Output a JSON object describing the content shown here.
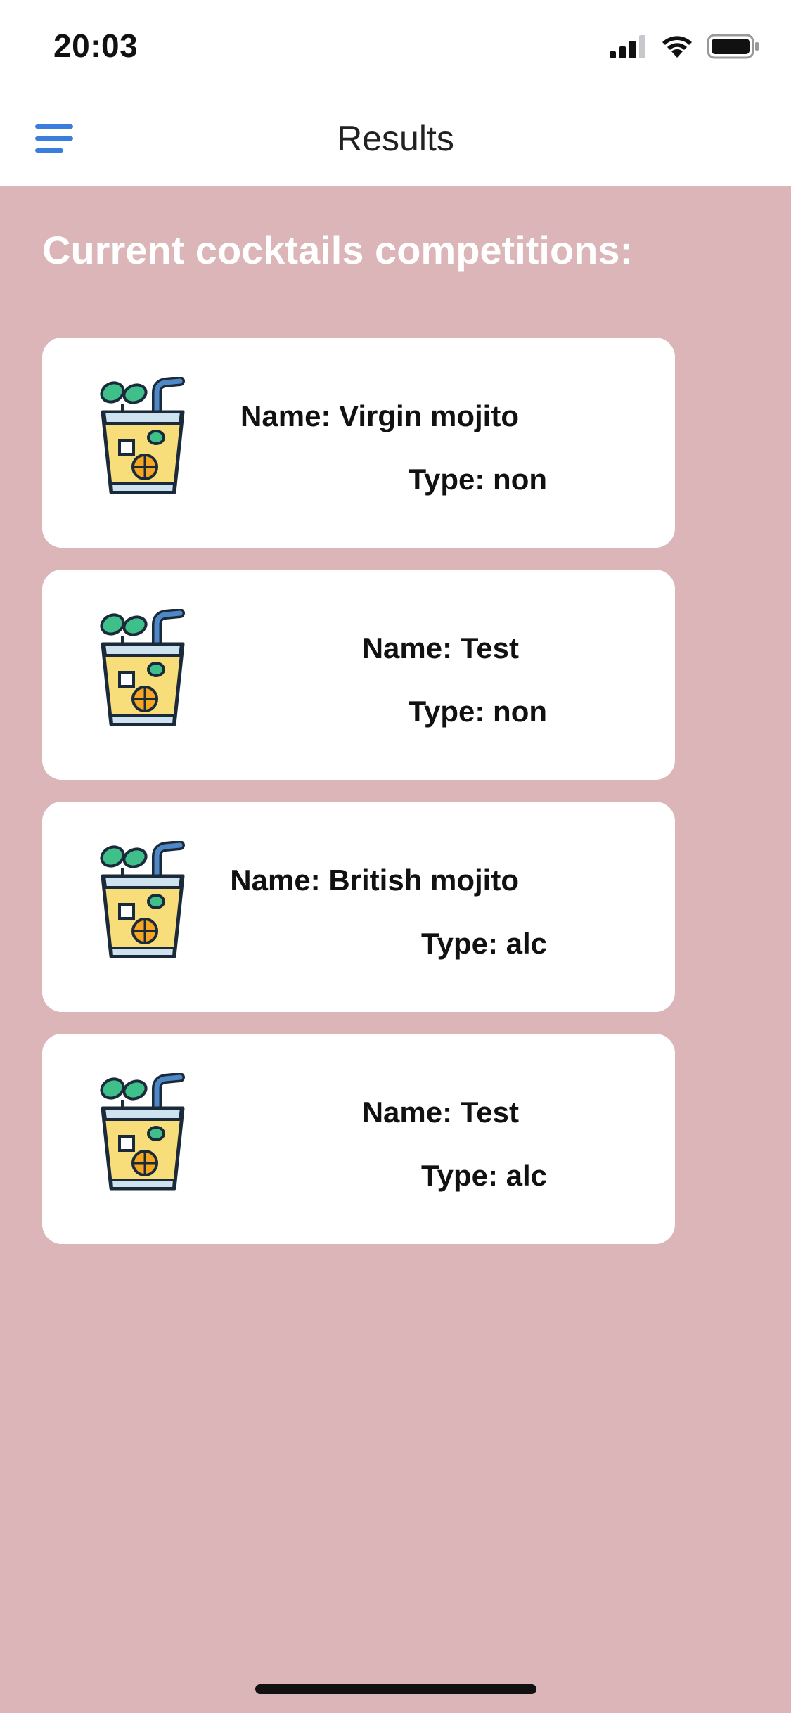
{
  "status_bar": {
    "time": "20:03",
    "icons": [
      "signal-icon",
      "wifi-icon",
      "battery-icon"
    ]
  },
  "nav": {
    "title": "Results",
    "menu_icon": "hamburger-menu-icon"
  },
  "section": {
    "title": "Current cocktails competitions:"
  },
  "cards": [
    {
      "name": "Name: Virgin mojito",
      "type": "Type: non",
      "icon": "cocktail-glass-icon"
    },
    {
      "name": "Name: Test",
      "type": "Type: non",
      "icon": "cocktail-glass-icon"
    },
    {
      "name": "Name: British mojito",
      "type": "Type: alc",
      "icon": "cocktail-glass-icon"
    },
    {
      "name": "Name: Test",
      "type": "Type: alc",
      "icon": "cocktail-glass-icon"
    }
  ],
  "colors": {
    "background": "#dbb5b7",
    "accent": "#3b7ddd",
    "card": "#ffffff"
  }
}
